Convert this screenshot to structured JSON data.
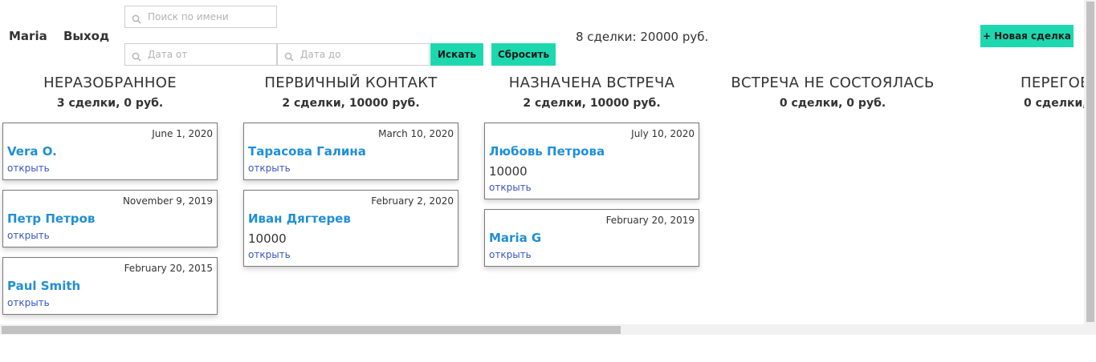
{
  "header": {
    "user_name": "Maria",
    "logout_label": "Выход",
    "search_placeholder": "Поиск по имени",
    "date_from_placeholder": "Дата от",
    "date_to_placeholder": "Дата до",
    "search_button": "Искать",
    "reset_button": "Сбросить",
    "summary": "8 сделки: 20000 руб.",
    "new_deal_button": "+ Новая сделка",
    "accent_color": "#1dd8ae"
  },
  "columns": [
    {
      "title": "НЕРАЗОБРАННОЕ",
      "subtitle": "3 сделки, 0 руб.",
      "cards": [
        {
          "date": "June 1, 2020",
          "name": "Vera O.",
          "open": "открыть"
        },
        {
          "date": "November 9, 2019",
          "name": "Петр Петров",
          "open": "открыть"
        },
        {
          "date": "February 20, 2015",
          "name": "Paul Smith",
          "open": "открыть"
        }
      ]
    },
    {
      "title": "ПЕРВИЧНЫЙ КОНТАКТ",
      "subtitle": "2 сделки, 10000 руб.",
      "cards": [
        {
          "date": "March 10, 2020",
          "name": "Тарасова Галина",
          "open": "открыть"
        },
        {
          "date": "February 2, 2020",
          "name": "Иван Дягтерев",
          "amount": "10000",
          "open": "открыть"
        }
      ]
    },
    {
      "title": "НАЗНАЧЕНА ВСТРЕЧА",
      "subtitle": "2 сделки, 10000 руб.",
      "cards": [
        {
          "date": "July 10, 2020",
          "name": "Любовь Петрова",
          "amount": "10000",
          "open": "открыть"
        },
        {
          "date": "February 20, 2019",
          "name": "Maria G",
          "open": "открыть"
        }
      ]
    },
    {
      "title": "ВСТРЕЧА НЕ СОСТОЯЛАСЬ",
      "subtitle": "0 сделки, 0 руб.",
      "cards": []
    },
    {
      "title": "ПЕРЕГОВ",
      "subtitle": "0 сделки,",
      "cards": []
    }
  ]
}
